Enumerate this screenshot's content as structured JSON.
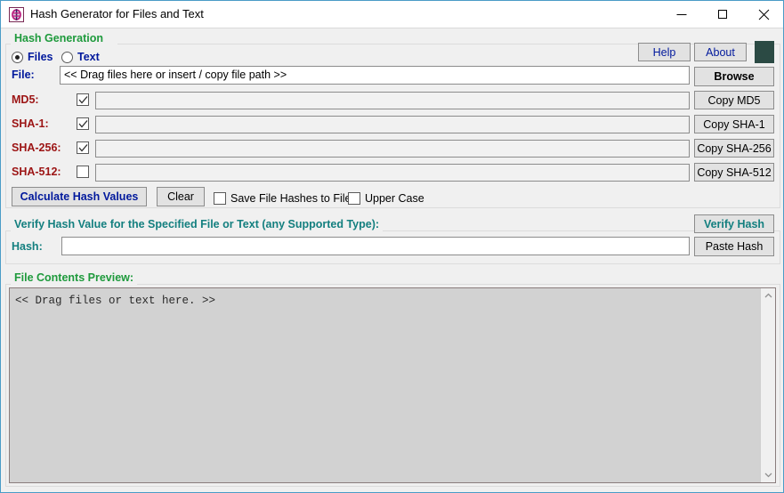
{
  "window": {
    "title": "Hash Generator for Files and Text",
    "icon": "app-hash-icon",
    "minimize": "—",
    "maximize": "□",
    "close": "✕"
  },
  "hash_generation": {
    "group_title": "Hash Generation",
    "mode": {
      "files_label": "Files",
      "text_label": "Text",
      "selected": "Files"
    },
    "file": {
      "label": "File:",
      "value": "<< Drag files here or insert / copy file path >>",
      "placeholder": "<< Drag files here or insert / copy file path >>"
    },
    "rows": [
      {
        "label": "MD5:",
        "checked": true,
        "value": "",
        "copy_label": "Copy MD5"
      },
      {
        "label": "SHA-1:",
        "checked": true,
        "value": "",
        "copy_label": "Copy SHA-1"
      },
      {
        "label": "SHA-256:",
        "checked": true,
        "value": "",
        "copy_label": "Copy SHA-256"
      },
      {
        "label": "SHA-512:",
        "checked": false,
        "value": "",
        "copy_label": "Copy SHA-512"
      }
    ],
    "calculate_label": "Calculate Hash Values",
    "clear_label": "Clear",
    "save_hashes_label": "Save File Hashes to Files",
    "save_hashes_checked": false,
    "upper_case_label": "Upper Case",
    "upper_case_checked": false,
    "help_label": "Help",
    "about_label": "About",
    "browse_label": "Browse",
    "status_indicator": "status-square"
  },
  "verify": {
    "group_title": "Verify Hash Value for the Specified File or Text (any Supported Type):",
    "hash_label": "Hash:",
    "hash_value": "",
    "verify_label": "Verify Hash",
    "paste_label": "Paste Hash"
  },
  "preview": {
    "group_title": "File Contents Preview:",
    "content": "<< Drag files or text here. >>",
    "scroll_up": "chevron-up-icon",
    "scroll_down": "chevron-down-icon"
  },
  "colors": {
    "green": "#1e9a3c",
    "teal": "#137f7f",
    "blue": "#00189c",
    "maroon": "#9c1414",
    "status": "#2b4a44",
    "window_border": "#4a9cc7"
  }
}
